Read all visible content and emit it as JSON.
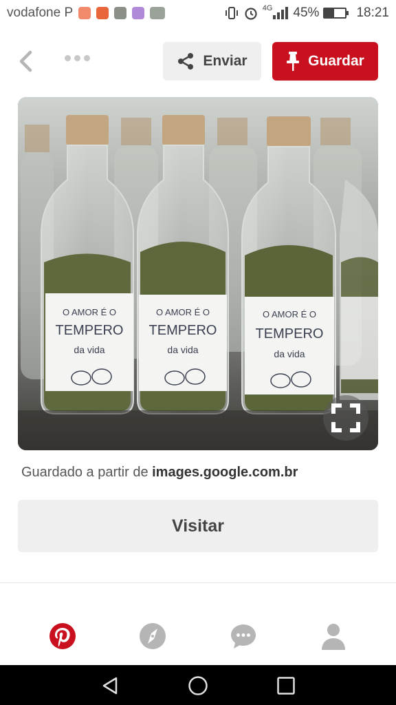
{
  "status_bar": {
    "carrier": "vodafone P",
    "network": "4G",
    "battery": "45%",
    "battery_level": 0.45,
    "time": "18:21"
  },
  "toolbar": {
    "send_label": "Enviar",
    "save_label": "Guardar"
  },
  "pin": {
    "image_label_lines": [
      "O AMOR É O",
      "TEMPERO",
      "da vida"
    ]
  },
  "source": {
    "prefix": "Guardado a partir de ",
    "domain": "images.google.com.br"
  },
  "visit_label": "Visitar",
  "colors": {
    "brand_red": "#c8101e",
    "button_gray": "#efefef"
  },
  "tabs": [
    "pinterest-home-icon",
    "explore-compass-icon",
    "messages-icon",
    "profile-icon"
  ]
}
